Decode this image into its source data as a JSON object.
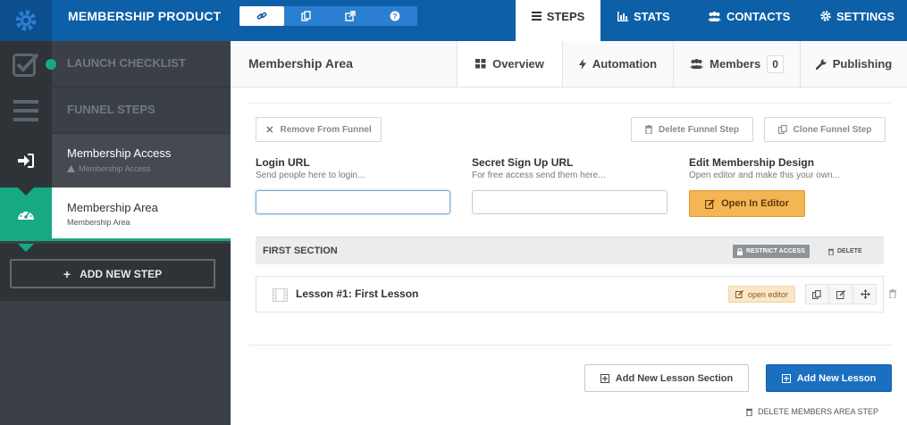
{
  "app": {
    "title": "MEMBERSHIP PRODUCT",
    "quick_tools": [
      "link-icon",
      "copy-icon",
      "external-link-icon",
      "help-icon"
    ]
  },
  "nav": {
    "steps": "STEPS",
    "stats": "STATS",
    "contacts": "CONTACTS",
    "settings": "SETTINGS"
  },
  "sidebar": {
    "launch_checklist": "LAUNCH CHECKLIST",
    "funnel_steps": "FUNNEL STEPS",
    "steps": [
      {
        "title": "Membership Access",
        "subtitle": "Membership Access"
      },
      {
        "title": "Membership Area",
        "subtitle": "Membership Area"
      }
    ],
    "add_step": "ADD NEW STEP"
  },
  "subheader": {
    "title": "Membership Area",
    "tabs": {
      "overview": "Overview",
      "automation": "Automation",
      "members": "Members",
      "members_count": "0",
      "publishing": "Publishing"
    }
  },
  "main": {
    "remove_from_funnel": "Remove From Funnel",
    "delete_funnel_step": "Delete Funnel Step",
    "clone_funnel_step": "Clone Funnel Step",
    "login_url": {
      "label": "Login URL",
      "help": "Send people here to login...",
      "value": ""
    },
    "signup_url": {
      "label": "Secret Sign Up URL",
      "help": "For free access send them here...",
      "value": ""
    },
    "edit_design": {
      "label": "Edit Membership Design",
      "help": "Open editor and make this your own...",
      "button": "Open In Editor"
    },
    "section": {
      "title": "FIRST SECTION",
      "restrict_access": "RESTRICT ACCESS",
      "delete": "DELETE"
    },
    "lesson": {
      "title": "Lesson #1: First Lesson",
      "open_editor": "open editor"
    },
    "add_lesson_section": "Add New Lesson Section",
    "add_lesson": "Add New Lesson",
    "delete_members_area": "DELETE MEMBERS AREA STEP"
  },
  "colors": {
    "topbar": "#0d5fa8",
    "sidebar": "#3b4047",
    "accent_green": "#16a982",
    "orange": "#f5b554",
    "blue_button": "#1a6fc0"
  }
}
